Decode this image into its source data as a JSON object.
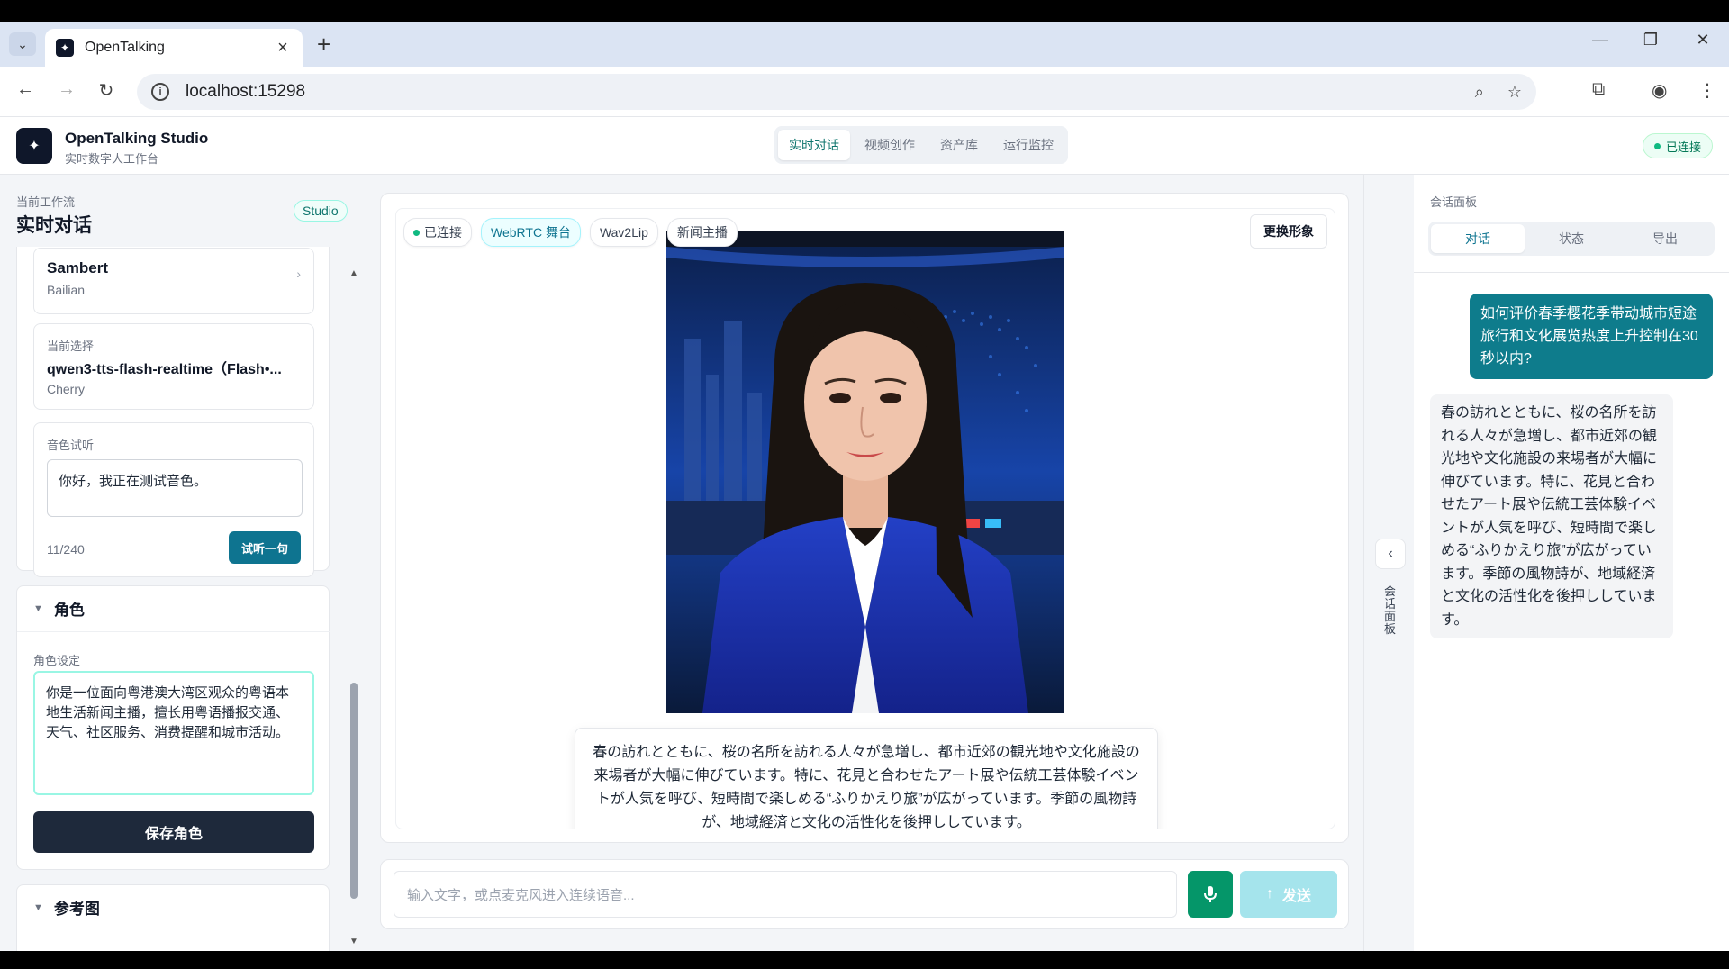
{
  "browser": {
    "tab_title": "OpenTalking",
    "url": "localhost:15298"
  },
  "header": {
    "app_name": "OpenTalking Studio",
    "app_subtitle": "实时数字人工作台",
    "nav": [
      "实时对话",
      "视频创作",
      "资产库",
      "运行监控"
    ],
    "active_nav": "实时对话",
    "status": "已连接"
  },
  "sidebar": {
    "workflow_label": "当前工作流",
    "workflow_title": "实时对话",
    "badge": "Studio",
    "voice_card": {
      "name": "Sambert",
      "provider": "Bailian"
    },
    "current": {
      "label": "当前选择",
      "model": "qwen3-tts-flash-realtime（Flash•...",
      "voice": "Cherry"
    },
    "preview": {
      "label": "音色试听",
      "text": "你好，我正在测试音色。",
      "counter": "11/240",
      "button": "试听一句"
    },
    "role": {
      "section": "角色",
      "label": "角色设定",
      "text": "你是一位面向粤港澳大湾区观众的粤语本地生活新闻主播，擅长用粤语播报交通、天气、社区服务、消费提醒和城市活动。",
      "save": "保存角色"
    },
    "reference_section": "参考图"
  },
  "stage": {
    "chips": [
      "已连接",
      "WebRTC 舞台",
      "Wav2Lip",
      "新闻主播"
    ],
    "change_avatar": "更换形象",
    "subtitle": "春の訪れとともに、桜の名所を訪れる人々が急増し、都市近郊の観光地や文化施設の来場者が大幅に伸びています。特に、花見と合わせたアート展や伝統工芸体験イベントが人気を呼び、短時間で楽しめる“ふりかえり旅”が広がっています。季節の風物詩が、地域経済と文化の活性化を後押ししています。"
  },
  "input": {
    "placeholder": "输入文字，或点麦克风进入连续语音...",
    "send": "发送"
  },
  "rail": {
    "label": "会话面板"
  },
  "session": {
    "title": "会话面板",
    "tabs": [
      "对话",
      "状态",
      "导出"
    ],
    "user_message": "如何评价春季樱花季带动城市短途旅行和文化展览热度上升控制在30秒以内?",
    "bot_message": "春の訪れとともに、桜の名所を訪れる人々が急増し、都市近郊の観光地や文化施設の来場者が大幅に伸びています。特に、花見と合わせたアート展や伝統工芸体験イベントが人気を呼び、短時間で楽しめる“ふりかえり旅”が広がっています。季節の風物詩が、地域経済と文化の活性化を後押ししています。"
  },
  "colors": {
    "accent": "#0e7490",
    "success": "#059669",
    "dark": "#1e293b"
  }
}
